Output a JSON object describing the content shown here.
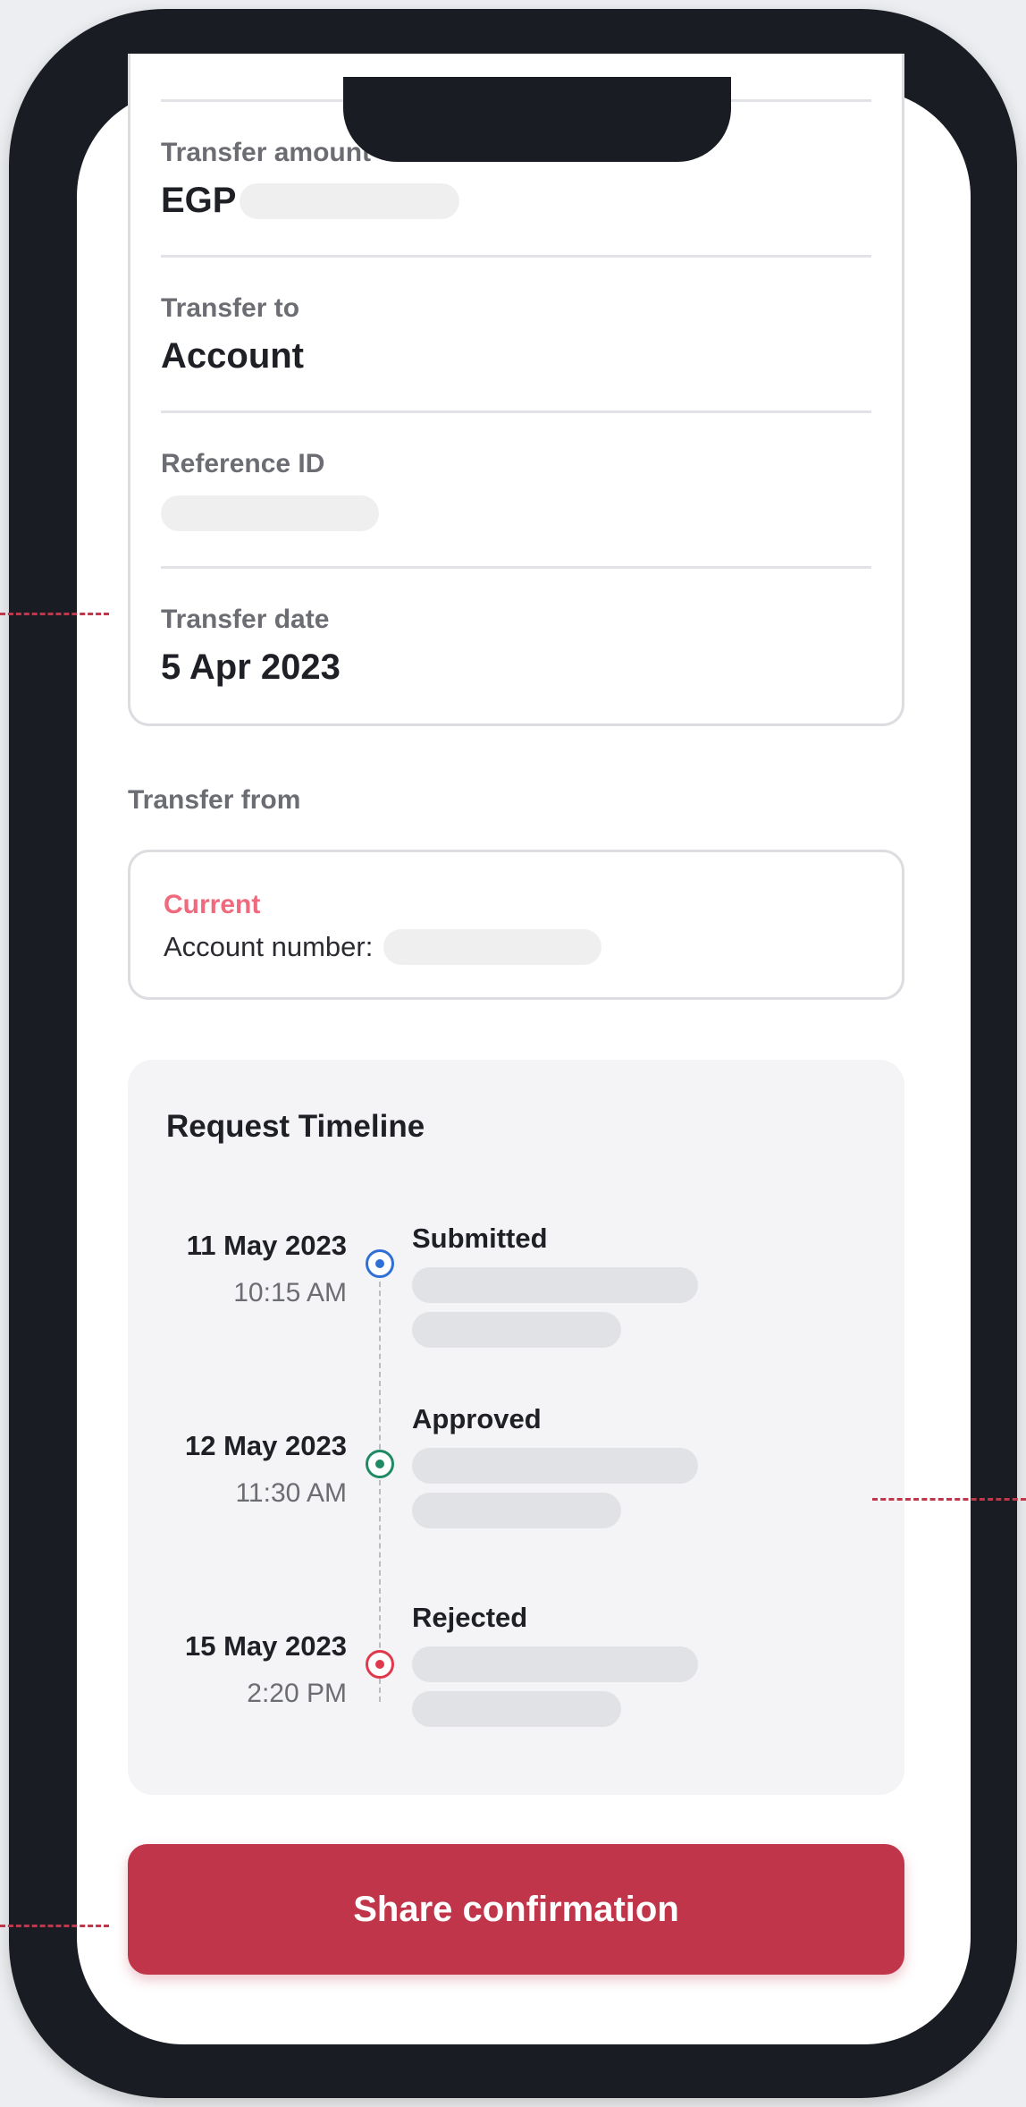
{
  "details": {
    "amount_label": "Transfer amount",
    "amount_currency": "EGP",
    "to_label": "Transfer to",
    "to_value": "Account",
    "reference_label": "Reference ID",
    "date_label": "Transfer date",
    "date_value": "5 Apr 2023"
  },
  "transfer_from": {
    "section_label": "Transfer from",
    "account_type": "Current",
    "account_number_label": "Account number:"
  },
  "timeline": {
    "title": "Request Timeline",
    "events": [
      {
        "date": "11 May 2023",
        "time": "10:15 AM",
        "status": "Submitted",
        "color": "#2f6fd6"
      },
      {
        "date": "12 May 2023",
        "time": "11:30 AM",
        "status": "Approved",
        "color": "#1f8a63"
      },
      {
        "date": "15 May 2023",
        "time": "2:20 PM",
        "status": "Rejected",
        "color": "#e0394b"
      }
    ]
  },
  "actions": {
    "share_label": "Share confirmation"
  },
  "colors": {
    "accent": "#c0354a",
    "account_type": "#f06a7d",
    "frame": "#1a1c23"
  },
  "icons": {
    "submitted": "status-dot-icon",
    "approved": "status-dot-icon",
    "rejected": "status-dot-icon"
  }
}
